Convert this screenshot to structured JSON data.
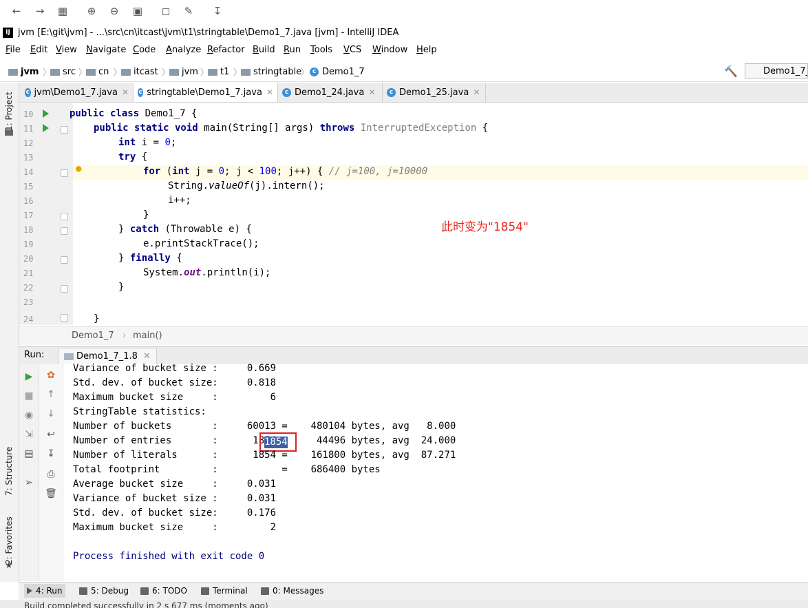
{
  "window": {
    "title": "jvm [E:\\git\\jvm] - ...\\src\\cn\\itcast\\jvm\\t1\\stringtable\\Demo1_7.java [jvm] - IntelliJ IDEA",
    "logo": "IJ"
  },
  "viewer_toolbar": [
    "back-icon",
    "forward-icon",
    "grid-icon",
    "zoom-in-icon",
    "zoom-out-icon",
    "fit-icon",
    "rotate-icon",
    "edit-icon",
    "save-icon"
  ],
  "menu": [
    "File",
    "Edit",
    "View",
    "Navigate",
    "Code",
    "Analyze",
    "Refactor",
    "Build",
    "Run",
    "Tools",
    "VCS",
    "Window",
    "Help"
  ],
  "breadcrumb": [
    "jvm",
    "src",
    "cn",
    "itcast",
    "jvm",
    "t1",
    "stringtable",
    "Demo1_7"
  ],
  "run_config": "Demo1_7_",
  "left_strip": {
    "project": "1: Project",
    "structure": "7: Structure",
    "favorites": "2: Favorites"
  },
  "editor_tabs": [
    {
      "label": "jvm\\Demo1_7.java",
      "active": false
    },
    {
      "label": "stringtable\\Demo1_7.java",
      "active": true
    },
    {
      "label": "Demo1_24.java",
      "active": false
    },
    {
      "label": "Demo1_25.java",
      "active": false
    }
  ],
  "code": {
    "line_numbers": [
      "10",
      "11",
      "12",
      "13",
      "14",
      "15",
      "16",
      "17",
      "18",
      "19",
      "20",
      "21",
      "22",
      "23",
      "24"
    ],
    "l10": {
      "a": "public class",
      "b": " Demo1_7 {"
    },
    "l11": {
      "a": "public static void",
      "b": " main(String[] args) ",
      "c": "throws",
      "d": " InterruptedException",
      "e": " {"
    },
    "l12": {
      "a": "int",
      "b": " i = ",
      "c": "0",
      "d": ";"
    },
    "l13": {
      "a": "try",
      "b": " {"
    },
    "l14": {
      "a": "for",
      "b": " (",
      "c": "int",
      "d": " j = ",
      "e": "0",
      "f": "; j < ",
      "g": "100",
      "h": "; j++) { ",
      "i": "// j=100, j=10000"
    },
    "l15": {
      "a": "String.",
      "b": "valueOf",
      "c": "(j).intern();"
    },
    "l16": "i++;",
    "l17": "}",
    "l18": {
      "a": "} ",
      "b": "catch",
      "c": " (Throwable e) {"
    },
    "l19": "e.printStackTrace();",
    "l20": {
      "a": "} ",
      "b": "finally",
      "c": " {"
    },
    "l21": {
      "a": "System.",
      "b": "out",
      "c": ".println(i);"
    },
    "l22": "}",
    "l24": "}"
  },
  "annotation": "此时变为\"1854\"",
  "editor_crumb": {
    "cls": "Demo1_7",
    "method": "main()"
  },
  "run": {
    "label": "Run:",
    "tab": "Demo1_7_1.8"
  },
  "console": [
    "Variance of bucket size :     0.669",
    "Std. dev. of bucket size:     0.818",
    "Maximum bucket size     :         6",
    "StringTable statistics:",
    "Number of buckets       :     60013 =    480104 bytes, avg   8.000",
    "Number of entries       :      1854 =     44496 bytes, avg  24.000",
    "Number of literals      :      1854 =    161800 bytes, avg  87.271",
    "Total footprint         :           =    686400 bytes",
    "Average bucket size     :     0.031",
    "Variance of bucket size :     0.031",
    "Std. dev. of bucket size:     0.176",
    "Maximum bucket size     :         2",
    "",
    "Process finished with exit code 0"
  ],
  "console_highlight": "1854",
  "bottom_tabs": [
    "4: Run",
    "5: Debug",
    "6: TODO",
    "Terminal",
    "0: Messages"
  ],
  "status": "Build completed successfully in 2 s 677 ms (moments ago)"
}
